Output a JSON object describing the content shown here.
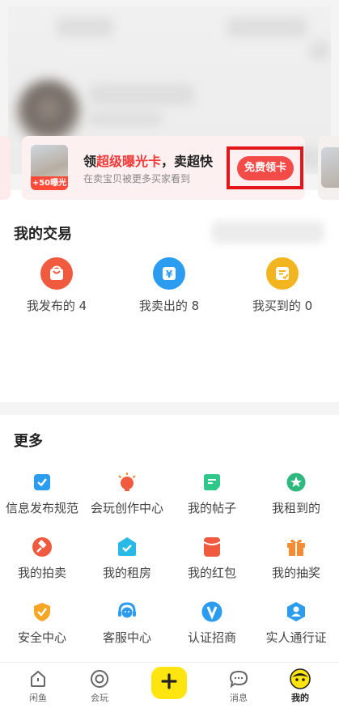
{
  "trade": {
    "title": "我的交易",
    "items": [
      {
        "label": "我发布的 4",
        "color": "#f05a3e",
        "icon": "bag-icon"
      },
      {
        "label": "我卖出的 8",
        "color": "#2b9cf0",
        "icon": "yen-tag-icon"
      },
      {
        "label": "我买到的 0",
        "color": "#f3b51f",
        "icon": "receipt-icon"
      }
    ]
  },
  "promo": {
    "thumb_badge": "+50曝光",
    "title_prefix": "领",
    "title_highlight": "超级曝光卡",
    "title_suffix": "，卖超快",
    "subtitle": "在卖宝贝被更多买家看到",
    "button": "免费领卡",
    "highlight_color": "#f03a3a"
  },
  "more": {
    "title": "更多",
    "items": [
      {
        "label": "信息发布规范",
        "icon": "checklist-icon",
        "color": "#2b9cf0"
      },
      {
        "label": "会玩创作中心",
        "icon": "lightbulb-icon",
        "color": "#f05a3e"
      },
      {
        "label": "我的帖子",
        "icon": "post-icon",
        "color": "#2fc78a"
      },
      {
        "label": "我租到的",
        "icon": "star-badge-icon",
        "color": "#2fb87e"
      },
      {
        "label": "我的拍卖",
        "icon": "gavel-icon",
        "color": "#f05a3e"
      },
      {
        "label": "我的租房",
        "icon": "house-check-icon",
        "color": "#28b9e6"
      },
      {
        "label": "我的红包",
        "icon": "red-packet-icon",
        "color": "#f05a3e"
      },
      {
        "label": "我的抽奖",
        "icon": "gift-icon",
        "color": "#f58b33"
      },
      {
        "label": "安全中心",
        "icon": "shield-icon",
        "color": "#f5a623"
      },
      {
        "label": "客服中心",
        "icon": "headset-icon",
        "color": "#2b9cf0"
      },
      {
        "label": "认证招商",
        "icon": "verified-v-icon",
        "color": "#2b9cf0"
      },
      {
        "label": "实人通行证",
        "icon": "person-badge-icon",
        "color": "#2b9cf0"
      }
    ]
  },
  "tabs": [
    {
      "label": "闲鱼",
      "icon": "home-icon"
    },
    {
      "label": "会玩",
      "icon": "circle-icon"
    },
    {
      "label": "",
      "icon": "plus-icon"
    },
    {
      "label": "消息",
      "icon": "message-icon"
    },
    {
      "label": "我的",
      "icon": "avatar-face-icon"
    }
  ],
  "colors": {
    "accent_yellow": "#ffe50f",
    "frame_red": "#e4141b"
  }
}
